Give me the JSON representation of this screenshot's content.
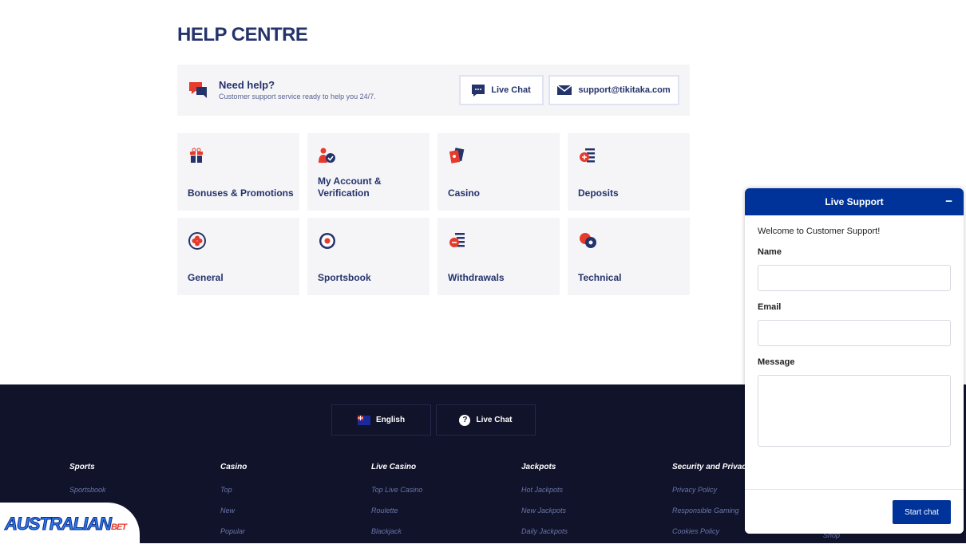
{
  "page": {
    "title": "HELP CENTRE"
  },
  "help_bar": {
    "heading": "Need help?",
    "subtext": "Customer support service ready to help you 24/7.",
    "live_chat": "Live Chat",
    "email": "support@tikitaka.com"
  },
  "categories": [
    {
      "label": "Bonuses & Promotions",
      "icon": "gift-icon"
    },
    {
      "label": "My Account & Verification",
      "icon": "user-check-icon"
    },
    {
      "label": "Casino",
      "icon": "cards-icon"
    },
    {
      "label": "Deposits",
      "icon": "deposit-icon"
    },
    {
      "label": "General",
      "icon": "clover-icon"
    },
    {
      "label": "Sportsbook",
      "icon": "football-icon"
    },
    {
      "label": "Withdrawals",
      "icon": "withdraw-icon"
    },
    {
      "label": "Technical",
      "icon": "gear-icon"
    }
  ],
  "footer": {
    "language": "English",
    "live_chat": "Live Chat",
    "columns": [
      {
        "title": "Sports",
        "links": [
          "Sportsbook"
        ]
      },
      {
        "title": "Casino",
        "links": [
          "Top",
          "New",
          "Popular"
        ]
      },
      {
        "title": "Live Casino",
        "links": [
          "Top Live Casino",
          "Roulette",
          "Blackjack"
        ]
      },
      {
        "title": "Jackpots",
        "links": [
          "Hot Jackpots",
          "New Jackpots",
          "Daily Jackpots"
        ]
      },
      {
        "title": "Security and Privacy",
        "links": [
          "Privacy Policy",
          "Responsible Gaming",
          "Cookies Policy"
        ]
      }
    ],
    "extra_link": "Shop"
  },
  "logo": {
    "text": "AUSTRALIAN",
    "suffix": "BET"
  },
  "widget": {
    "title": "Live Support",
    "welcome": "Welcome to Customer Support!",
    "name_label": "Name",
    "email_label": "Email",
    "message_label": "Message",
    "submit": "Start chat"
  },
  "colors": {
    "brand": "#25336b",
    "accent": "#e53b2c",
    "widget_blue": "#003399",
    "footer_bg": "#10132a"
  }
}
